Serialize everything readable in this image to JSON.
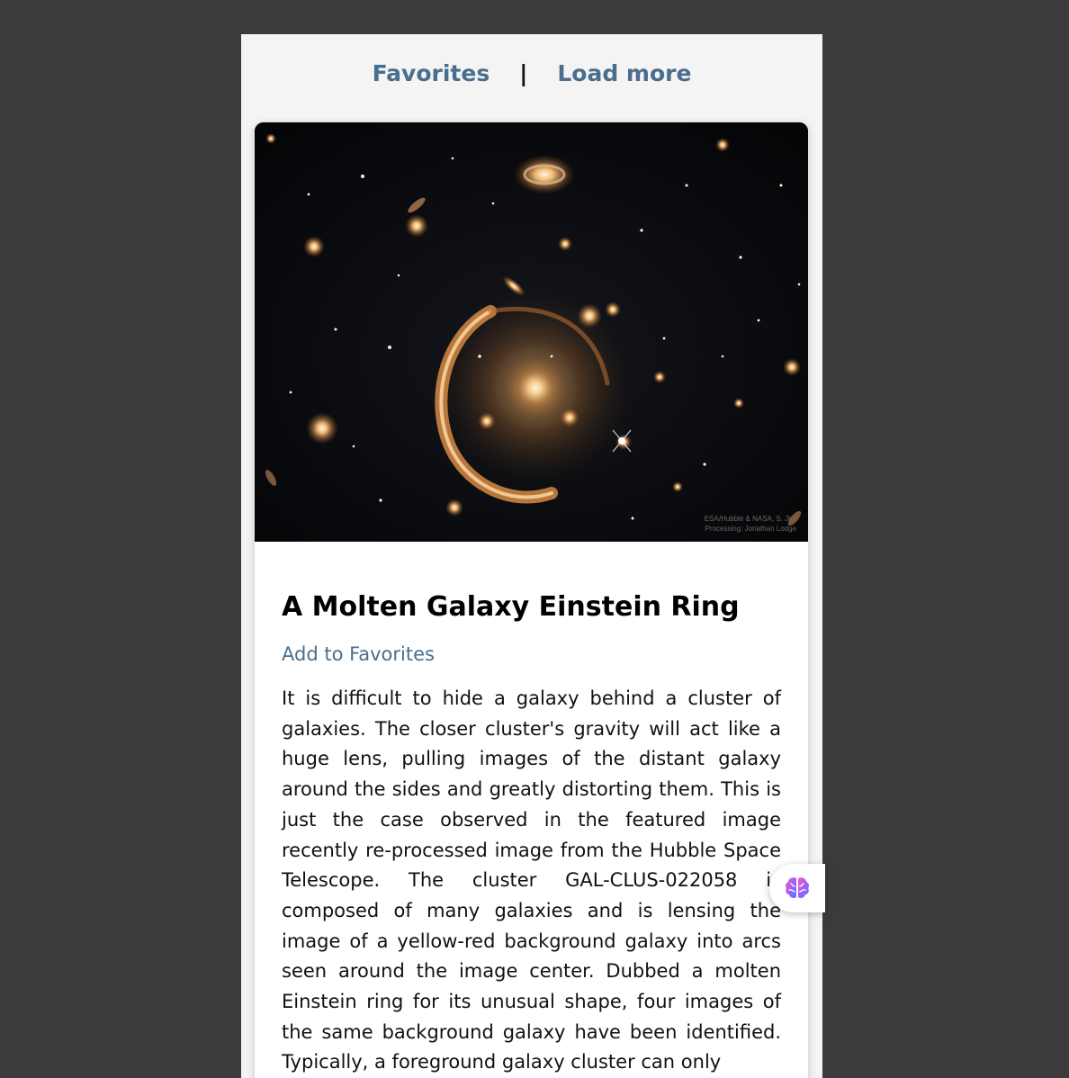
{
  "nav": {
    "favorites": "Favorites",
    "separator": "|",
    "load_more": "Load more"
  },
  "apod": {
    "image_credit_line1": "ESA/Hubble & NASA, S. Jha",
    "image_credit_line2": "Processing: Jonathan Lodge",
    "title": "A Molten Galaxy Einstein Ring",
    "add_favorite": "Add to Favorites",
    "explanation": "It is difficult to hide a galaxy behind a cluster of galaxies. The closer cluster's gravity will act like a huge lens, pulling images of the distant galaxy around the sides and greatly distorting them. This is just the case observed in the featured image recently re-processed image from the Hubble Space Telescope. The cluster GAL-CLUS-022058 is composed of many galaxies and is lensing the image of a yellow-red background galaxy into arcs seen around the image center. Dubbed a molten Einstein ring for its unusual shape, four images of the same background galaxy have been identified. Typically, a foreground galaxy cluster can only"
  },
  "widget": {
    "icon": "brain-icon"
  },
  "colors": {
    "page_background": "#3b3b3b",
    "panel_background": "#f4f4f4",
    "link": "#4a6e8c",
    "card": "#ffffff"
  }
}
